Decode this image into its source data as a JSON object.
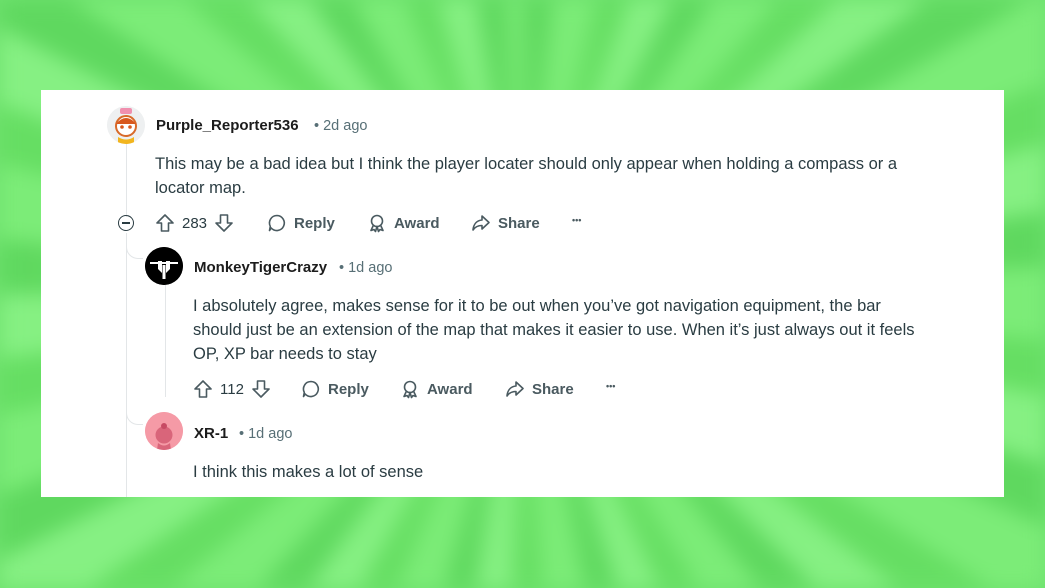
{
  "comments": [
    {
      "username": "Purple_Reporter536",
      "time": "• 2d ago",
      "body_lines": [
        "This may be a bad idea but I think the player locater should only appear when holding a compass or a",
        "locator map."
      ],
      "votes": "283",
      "reply_label": "Reply",
      "award_label": "Award",
      "share_label": "Share",
      "more_label": "•••"
    },
    {
      "username": "MonkeyTigerCrazy",
      "time": "• 1d ago",
      "body_lines": [
        "I absolutely agree, makes sense for it to be out when you’ve got navigation equipment, the bar",
        "should just be an extension of the map that makes it easier to use. When it’s just always out it feels",
        "OP, XP bar needs to stay"
      ],
      "votes": "112",
      "reply_label": "Reply",
      "award_label": "Award",
      "share_label": "Share",
      "more_label": "•••"
    },
    {
      "username": "XR-1",
      "time": "• 1d ago",
      "body_lines": [
        "I think this makes a lot of sense"
      ]
    }
  ],
  "colors": {
    "background_green": "#6fe26f",
    "card": "#ffffff",
    "text": "#2a3c42",
    "meta": "#576f76"
  }
}
